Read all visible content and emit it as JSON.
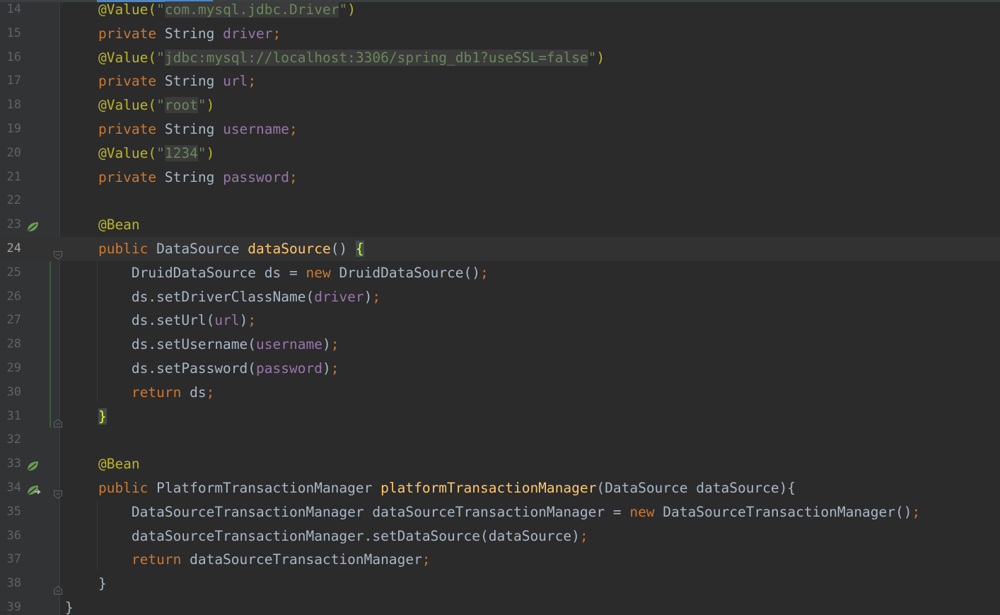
{
  "editor": {
    "lines": [
      {
        "n": "14",
        "parts": [
          [
            "ann",
            "    @Value("
          ],
          [
            "str",
            "\""
          ],
          [
            "strval",
            "com.mysql.jdbc.Driver"
          ],
          [
            "str",
            "\""
          ],
          [
            "ann",
            ")"
          ]
        ]
      },
      {
        "n": "15",
        "parts": [
          [
            "kw",
            "    private "
          ],
          [
            "plain",
            "String "
          ],
          [
            "fld",
            "driver"
          ],
          [
            "kw",
            ";"
          ]
        ]
      },
      {
        "n": "16",
        "parts": [
          [
            "ann",
            "    @Value("
          ],
          [
            "str",
            "\""
          ],
          [
            "strval",
            "jdbc:mysql://localhost:3306/spring_db1?useSSL=false"
          ],
          [
            "str",
            "\""
          ],
          [
            "ann",
            ")"
          ]
        ]
      },
      {
        "n": "17",
        "parts": [
          [
            "kw",
            "    private "
          ],
          [
            "plain",
            "String "
          ],
          [
            "fld",
            "url"
          ],
          [
            "kw",
            ";"
          ]
        ]
      },
      {
        "n": "18",
        "parts": [
          [
            "ann",
            "    @Value("
          ],
          [
            "str",
            "\""
          ],
          [
            "strval",
            "root"
          ],
          [
            "str",
            "\""
          ],
          [
            "ann",
            ")"
          ]
        ]
      },
      {
        "n": "19",
        "parts": [
          [
            "kw",
            "    private "
          ],
          [
            "plain",
            "String "
          ],
          [
            "fld",
            "username"
          ],
          [
            "kw",
            ";"
          ]
        ]
      },
      {
        "n": "20",
        "parts": [
          [
            "ann",
            "    @Value("
          ],
          [
            "str",
            "\""
          ],
          [
            "strval",
            "1234"
          ],
          [
            "str",
            "\""
          ],
          [
            "ann",
            ")"
          ]
        ]
      },
      {
        "n": "21",
        "parts": [
          [
            "kw",
            "    private "
          ],
          [
            "plain",
            "String "
          ],
          [
            "fld",
            "password"
          ],
          [
            "kw",
            ";"
          ]
        ]
      },
      {
        "n": "22",
        "parts": []
      },
      {
        "n": "23",
        "marker": "bean",
        "parts": [
          [
            "ann",
            "    @Bean"
          ]
        ]
      },
      {
        "n": "24",
        "current": true,
        "fold": "open",
        "parts": [
          [
            "kw",
            "    public "
          ],
          [
            "plain",
            "DataSource "
          ],
          [
            "mth",
            "dataSource"
          ],
          [
            "plain",
            "() "
          ],
          [
            "bracehl",
            "{"
          ]
        ]
      },
      {
        "n": "25",
        "parts": [
          [
            "plain",
            "        DruidDataSource ds = "
          ],
          [
            "kw",
            "new "
          ],
          [
            "plain",
            "DruidDataSource()"
          ],
          [
            "kw",
            ";"
          ]
        ]
      },
      {
        "n": "26",
        "parts": [
          [
            "plain",
            "        ds.setDriverClassName("
          ],
          [
            "fld",
            "driver"
          ],
          [
            "plain",
            ")"
          ],
          [
            "kw",
            ";"
          ]
        ]
      },
      {
        "n": "27",
        "parts": [
          [
            "plain",
            "        ds.setUrl("
          ],
          [
            "fld",
            "url"
          ],
          [
            "plain",
            ")"
          ],
          [
            "kw",
            ";"
          ]
        ]
      },
      {
        "n": "28",
        "parts": [
          [
            "plain",
            "        ds.setUsername("
          ],
          [
            "fld",
            "username"
          ],
          [
            "plain",
            ")"
          ],
          [
            "kw",
            ";"
          ]
        ]
      },
      {
        "n": "29",
        "parts": [
          [
            "plain",
            "        ds.setPassword("
          ],
          [
            "fld",
            "password"
          ],
          [
            "plain",
            ")"
          ],
          [
            "kw",
            ";"
          ]
        ]
      },
      {
        "n": "30",
        "parts": [
          [
            "kw",
            "        return "
          ],
          [
            "plain",
            "ds"
          ],
          [
            "kw",
            ";"
          ]
        ]
      },
      {
        "n": "31",
        "fold": "close",
        "parts": [
          [
            "plain",
            "    "
          ],
          [
            "bracehl",
            "}"
          ]
        ]
      },
      {
        "n": "32",
        "parts": []
      },
      {
        "n": "33",
        "marker": "bean",
        "parts": [
          [
            "ann",
            "    @Bean"
          ]
        ]
      },
      {
        "n": "34",
        "marker": "bean-arrow",
        "fold": "open",
        "parts": [
          [
            "kw",
            "    public "
          ],
          [
            "plain",
            "PlatformTransactionManager "
          ],
          [
            "mth",
            "platformTransactionManager"
          ],
          [
            "plain",
            "(DataSource dataSource){"
          ]
        ]
      },
      {
        "n": "35",
        "parts": [
          [
            "plain",
            "        DataSourceTransactionManager dataSourceTransactionManager = "
          ],
          [
            "kw",
            "new "
          ],
          [
            "plain",
            "DataSourceTransactionManager()"
          ],
          [
            "kw",
            ";"
          ]
        ]
      },
      {
        "n": "36",
        "parts": [
          [
            "plain",
            "        dataSourceTransactionManager.setDataSource(dataSource)"
          ],
          [
            "kw",
            ";"
          ]
        ]
      },
      {
        "n": "37",
        "parts": [
          [
            "kw",
            "        return "
          ],
          [
            "plain",
            "dataSourceTransactionManager"
          ],
          [
            "kw",
            ";"
          ]
        ]
      },
      {
        "n": "38",
        "fold": "close",
        "parts": [
          [
            "plain",
            "    }"
          ]
        ]
      },
      {
        "n": "39",
        "parts": [
          [
            "plain",
            "}"
          ]
        ]
      }
    ]
  }
}
